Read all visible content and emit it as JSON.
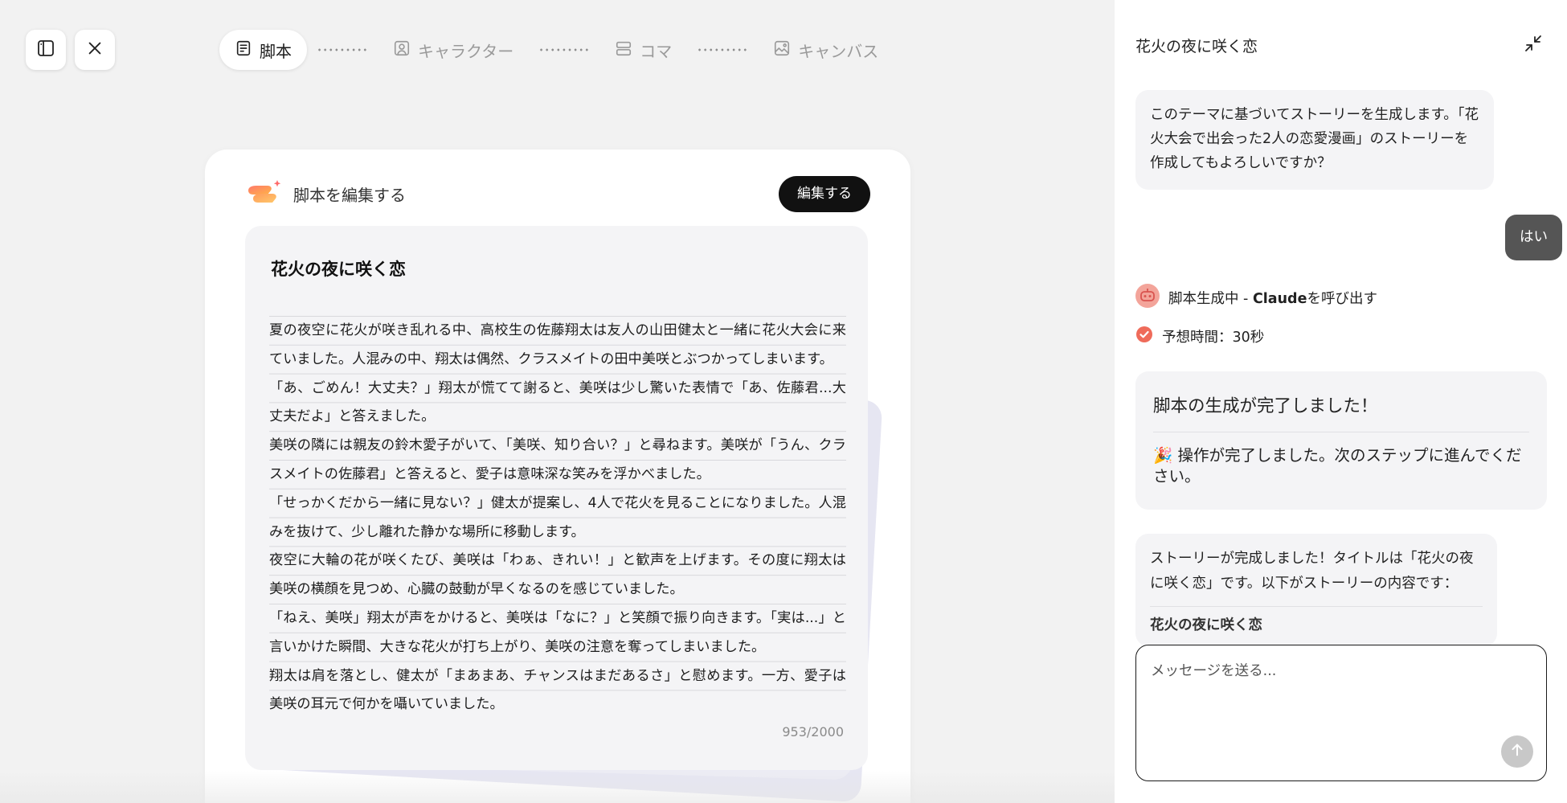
{
  "toolbar": {
    "sidebar_toggle_icon": "sidebar-panel-icon",
    "close_icon": "close-icon"
  },
  "stepper": {
    "steps": [
      {
        "label": "脚本",
        "icon": "document-icon",
        "active": true
      },
      {
        "label": "キャラクター",
        "icon": "user-card-icon",
        "active": false
      },
      {
        "label": "コマ",
        "icon": "panels-icon",
        "active": false
      },
      {
        "label": "キャンバス",
        "icon": "image-icon",
        "active": false
      }
    ]
  },
  "editor": {
    "header_label": "脚本を編集する",
    "edit_button": "編集する",
    "title": "花火の夜に咲く恋",
    "paragraphs": [
      "夏の夜空に花火が咲き乱れる中、高校生の佐藤翔太は友人の山田健太と一緒に花火大会に来ていました。人混みの中、翔太は偶然、クラスメイトの田中美咲とぶつかってしまいます。",
      "「あ、ごめん！大丈夫？」翔太が慌てて謝ると、美咲は少し驚いた表情で「あ、佐藤君...大丈夫だよ」と答えました。",
      "美咲の隣には親友の鈴木愛子がいて、「美咲、知り合い？」と尋ねます。美咲が「うん、クラスメイトの佐藤君」と答えると、愛子は意味深な笑みを浮かべました。",
      "「せっかくだから一緒に見ない？」健太が提案し、4人で花火を見ることになりました。人混みを抜けて、少し離れた静かな場所に移動します。",
      "夜空に大輪の花が咲くたび、美咲は「わぁ、きれい！」と歓声を上げます。その度に翔太は美咲の横顔を見つめ、心臓の鼓動が早くなるのを感じていました。",
      "「ねえ、美咲」翔太が声をかけると、美咲は「なに？」と笑顔で振り向きます。「実は...」と言いかけた瞬間、大きな花火が打ち上がり、美咲の注意を奪ってしまいました。",
      "翔太は肩を落とし、健太が「まあまあ、チャンスはまだあるさ」と慰めます。一方、愛子は美咲の耳元で何かを囁いていました。"
    ],
    "char_count": "953/2000"
  },
  "chat": {
    "title": "花火の夜に咲く恋",
    "collapse_icon": "collapse-arrows-icon",
    "assistant_message_1": "このテーマに基づいてストーリーを生成します。「花火大会で出会った2人の恋愛漫画」のストーリーを作成してもよろしいですか？",
    "user_message": "はい",
    "status_generating_prefix": "脚本生成中 - ",
    "status_generating_bold": "Claude",
    "status_generating_suffix": "を呼び出す",
    "status_estimate": "予想時間：30秒",
    "done_title": "脚本の生成が完了しました！",
    "done_message": "🎉 操作が完了しました。次のステップに進んでください。",
    "story_message": "ストーリーが完成しました！タイトルは「花火の夜に咲く恋」です。以下がストーリーの内容です：",
    "story_subtitle": "花火の夜に咲く恋",
    "composer_placeholder": "メッセージを送る...",
    "colors": {
      "accent": "#ef6b5a",
      "user_bubble": "#555555",
      "bubble_bg": "#f4f4f6"
    }
  }
}
